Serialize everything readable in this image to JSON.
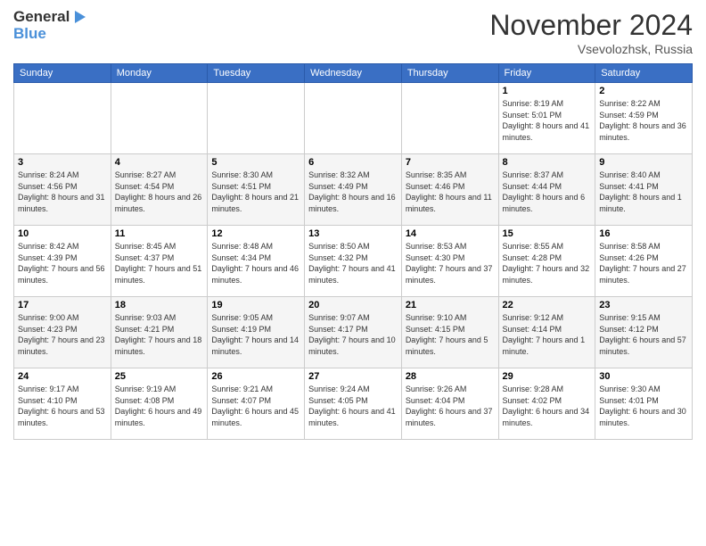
{
  "logo": {
    "line1": "General",
    "line2": "Blue"
  },
  "title": "November 2024",
  "location": "Vsevolozhsk, Russia",
  "header_days": [
    "Sunday",
    "Monday",
    "Tuesday",
    "Wednesday",
    "Thursday",
    "Friday",
    "Saturday"
  ],
  "weeks": [
    [
      {
        "day": "",
        "info": ""
      },
      {
        "day": "",
        "info": ""
      },
      {
        "day": "",
        "info": ""
      },
      {
        "day": "",
        "info": ""
      },
      {
        "day": "",
        "info": ""
      },
      {
        "day": "1",
        "info": "Sunrise: 8:19 AM\nSunset: 5:01 PM\nDaylight: 8 hours and 41 minutes."
      },
      {
        "day": "2",
        "info": "Sunrise: 8:22 AM\nSunset: 4:59 PM\nDaylight: 8 hours and 36 minutes."
      }
    ],
    [
      {
        "day": "3",
        "info": "Sunrise: 8:24 AM\nSunset: 4:56 PM\nDaylight: 8 hours and 31 minutes."
      },
      {
        "day": "4",
        "info": "Sunrise: 8:27 AM\nSunset: 4:54 PM\nDaylight: 8 hours and 26 minutes."
      },
      {
        "day": "5",
        "info": "Sunrise: 8:30 AM\nSunset: 4:51 PM\nDaylight: 8 hours and 21 minutes."
      },
      {
        "day": "6",
        "info": "Sunrise: 8:32 AM\nSunset: 4:49 PM\nDaylight: 8 hours and 16 minutes."
      },
      {
        "day": "7",
        "info": "Sunrise: 8:35 AM\nSunset: 4:46 PM\nDaylight: 8 hours and 11 minutes."
      },
      {
        "day": "8",
        "info": "Sunrise: 8:37 AM\nSunset: 4:44 PM\nDaylight: 8 hours and 6 minutes."
      },
      {
        "day": "9",
        "info": "Sunrise: 8:40 AM\nSunset: 4:41 PM\nDaylight: 8 hours and 1 minute."
      }
    ],
    [
      {
        "day": "10",
        "info": "Sunrise: 8:42 AM\nSunset: 4:39 PM\nDaylight: 7 hours and 56 minutes."
      },
      {
        "day": "11",
        "info": "Sunrise: 8:45 AM\nSunset: 4:37 PM\nDaylight: 7 hours and 51 minutes."
      },
      {
        "day": "12",
        "info": "Sunrise: 8:48 AM\nSunset: 4:34 PM\nDaylight: 7 hours and 46 minutes."
      },
      {
        "day": "13",
        "info": "Sunrise: 8:50 AM\nSunset: 4:32 PM\nDaylight: 7 hours and 41 minutes."
      },
      {
        "day": "14",
        "info": "Sunrise: 8:53 AM\nSunset: 4:30 PM\nDaylight: 7 hours and 37 minutes."
      },
      {
        "day": "15",
        "info": "Sunrise: 8:55 AM\nSunset: 4:28 PM\nDaylight: 7 hours and 32 minutes."
      },
      {
        "day": "16",
        "info": "Sunrise: 8:58 AM\nSunset: 4:26 PM\nDaylight: 7 hours and 27 minutes."
      }
    ],
    [
      {
        "day": "17",
        "info": "Sunrise: 9:00 AM\nSunset: 4:23 PM\nDaylight: 7 hours and 23 minutes."
      },
      {
        "day": "18",
        "info": "Sunrise: 9:03 AM\nSunset: 4:21 PM\nDaylight: 7 hours and 18 minutes."
      },
      {
        "day": "19",
        "info": "Sunrise: 9:05 AM\nSunset: 4:19 PM\nDaylight: 7 hours and 14 minutes."
      },
      {
        "day": "20",
        "info": "Sunrise: 9:07 AM\nSunset: 4:17 PM\nDaylight: 7 hours and 10 minutes."
      },
      {
        "day": "21",
        "info": "Sunrise: 9:10 AM\nSunset: 4:15 PM\nDaylight: 7 hours and 5 minutes."
      },
      {
        "day": "22",
        "info": "Sunrise: 9:12 AM\nSunset: 4:14 PM\nDaylight: 7 hours and 1 minute."
      },
      {
        "day": "23",
        "info": "Sunrise: 9:15 AM\nSunset: 4:12 PM\nDaylight: 6 hours and 57 minutes."
      }
    ],
    [
      {
        "day": "24",
        "info": "Sunrise: 9:17 AM\nSunset: 4:10 PM\nDaylight: 6 hours and 53 minutes."
      },
      {
        "day": "25",
        "info": "Sunrise: 9:19 AM\nSunset: 4:08 PM\nDaylight: 6 hours and 49 minutes."
      },
      {
        "day": "26",
        "info": "Sunrise: 9:21 AM\nSunset: 4:07 PM\nDaylight: 6 hours and 45 minutes."
      },
      {
        "day": "27",
        "info": "Sunrise: 9:24 AM\nSunset: 4:05 PM\nDaylight: 6 hours and 41 minutes."
      },
      {
        "day": "28",
        "info": "Sunrise: 9:26 AM\nSunset: 4:04 PM\nDaylight: 6 hours and 37 minutes."
      },
      {
        "day": "29",
        "info": "Sunrise: 9:28 AM\nSunset: 4:02 PM\nDaylight: 6 hours and 34 minutes."
      },
      {
        "day": "30",
        "info": "Sunrise: 9:30 AM\nSunset: 4:01 PM\nDaylight: 6 hours and 30 minutes."
      }
    ]
  ]
}
